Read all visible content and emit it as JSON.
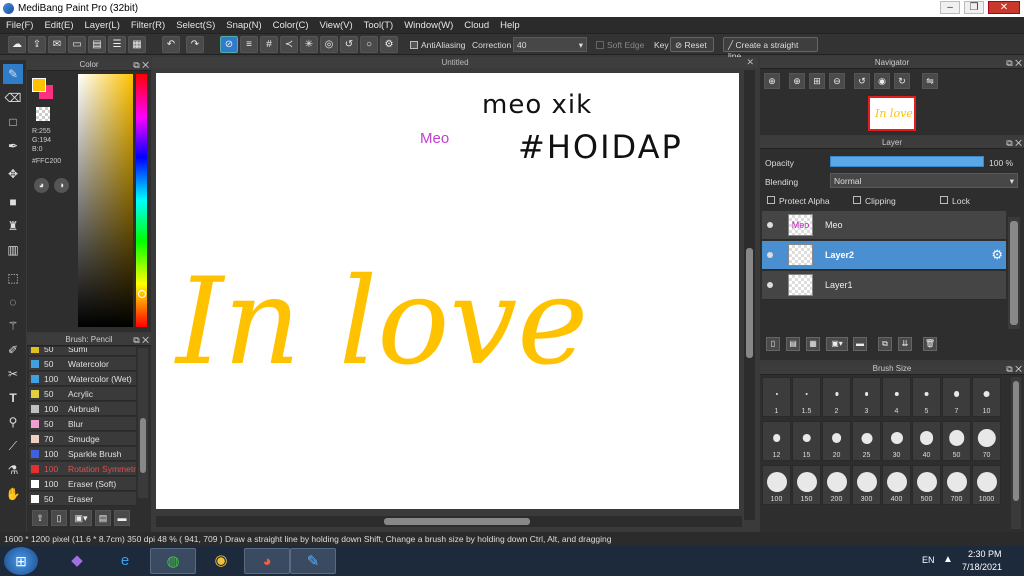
{
  "window": {
    "title": "MediBang Paint Pro (32bit)",
    "min": "–",
    "max": "❐",
    "close": "✕"
  },
  "menu": [
    "File(F)",
    "Edit(E)",
    "Layer(L)",
    "Filter(R)",
    "Select(S)",
    "Snap(N)",
    "Color(C)",
    "View(V)",
    "Tool(T)",
    "Window(W)",
    "Cloud",
    "Help"
  ],
  "toolbar": {
    "antialiasing_label": "AntiAliasing",
    "correction_label": "Correction",
    "correction_value": "40",
    "soft_edge_label": "Soft Edge",
    "key_label": "Key",
    "reset_label": "Reset",
    "straight_line_label": "Create a straight line"
  },
  "color_panel": {
    "title": "Color",
    "r": "R:255",
    "g": "G:194",
    "b": "B:0",
    "hex": "#FFC200",
    "fg": "#ffc200",
    "bg": "#ff3080"
  },
  "brush_panel": {
    "title": "Brush: Pencil",
    "items": [
      {
        "size": "50",
        "name": "Sumi",
        "color": "#e0c020"
      },
      {
        "size": "50",
        "name": "Watercolor",
        "color": "#40a0e0"
      },
      {
        "size": "100",
        "name": "Watercolor (Wet)",
        "color": "#40a0e0"
      },
      {
        "size": "50",
        "name": "Acrylic",
        "color": "#e0d040"
      },
      {
        "size": "100",
        "name": "Airbrush",
        "color": "#c0c0c0"
      },
      {
        "size": "50",
        "name": "Blur",
        "color": "#f0a0d0"
      },
      {
        "size": "70",
        "name": "Smudge",
        "color": "#f0d0c0"
      },
      {
        "size": "100",
        "name": "Sparkle Brush",
        "color": "#4060e0"
      },
      {
        "size": "100",
        "name": "Rotation Symmetry",
        "color": "#e03030"
      },
      {
        "size": "100",
        "name": "Eraser (Soft)",
        "color": "#ffffff"
      },
      {
        "size": "50",
        "name": "Eraser",
        "color": "#ffffff"
      }
    ]
  },
  "canvas": {
    "title": "Untitled",
    "texts": {
      "meo_small": "Meo",
      "meo_xik": "meo xik",
      "hoidap": "#HOIDAP",
      "in_love": "In love"
    }
  },
  "navigator": {
    "title": "Navigator",
    "thumb_text": "In love"
  },
  "layer_panel": {
    "title": "Layer",
    "opacity_label": "Opacity",
    "opacity_value": "100 %",
    "opacity_fraction": 1.0,
    "blending_label": "Blending",
    "blending_value": "Normal",
    "protect_alpha": "Protect Alpha",
    "clipping": "Clipping",
    "lock": "Lock",
    "layers": [
      {
        "name": "Meo",
        "thumb": "Meo",
        "selected": false
      },
      {
        "name": "Layer2",
        "thumb": "",
        "selected": true
      },
      {
        "name": "Layer1",
        "thumb": "",
        "selected": false
      }
    ]
  },
  "brush_size_panel": {
    "title": "Brush Size",
    "sizes": [
      "1",
      "1.5",
      "2",
      "3",
      "4",
      "5",
      "7",
      "10",
      "12",
      "15",
      "20",
      "25",
      "30",
      "40",
      "50",
      "70",
      "100",
      "150",
      "200",
      "300",
      "400",
      "500",
      "700",
      "1000"
    ]
  },
  "status": {
    "text": "1600 * 1200 pixel   (11.6 * 8.7cm)   350 dpi   48 %   ( 941, 709 )   Draw a straight line by holding down Shift, Change a brush size by holding down Ctrl, Alt, and dragging"
  },
  "taskbar": {
    "lang": "EN",
    "time": "2:30 PM",
    "date": "7/18/2021"
  }
}
